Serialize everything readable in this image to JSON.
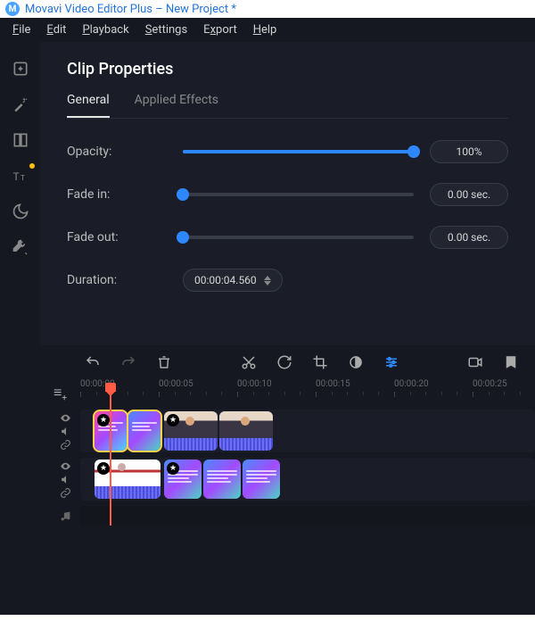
{
  "titlebar": {
    "title": "Movavi Video Editor Plus – New Project *"
  },
  "menu": {
    "file": "File",
    "edit": "Edit",
    "playback": "Playback",
    "settings": "Settings",
    "export": "Export",
    "help": "Help"
  },
  "sidebar": {
    "icons": [
      "add",
      "wand",
      "filters",
      "titles",
      "moon",
      "tools"
    ]
  },
  "panel": {
    "title": "Clip Properties",
    "tabs": {
      "general": "General",
      "effects": "Applied Effects",
      "active": "general"
    },
    "opacity": {
      "label": "Opacity:",
      "value": "100%",
      "percent": 100
    },
    "fadeIn": {
      "label": "Fade in:",
      "value": "0.00 sec.",
      "percent": 0
    },
    "fadeOut": {
      "label": "Fade out:",
      "value": "0.00 sec.",
      "percent": 0
    },
    "duration": {
      "label": "Duration:",
      "value": "00:00:04.560"
    }
  },
  "timeline": {
    "ruler": [
      "00:00:00",
      "00:00:05",
      "00:00:10",
      "00:00:15",
      "00:00:20",
      "00:00:25"
    ],
    "playheadLeftPx": 66
  }
}
